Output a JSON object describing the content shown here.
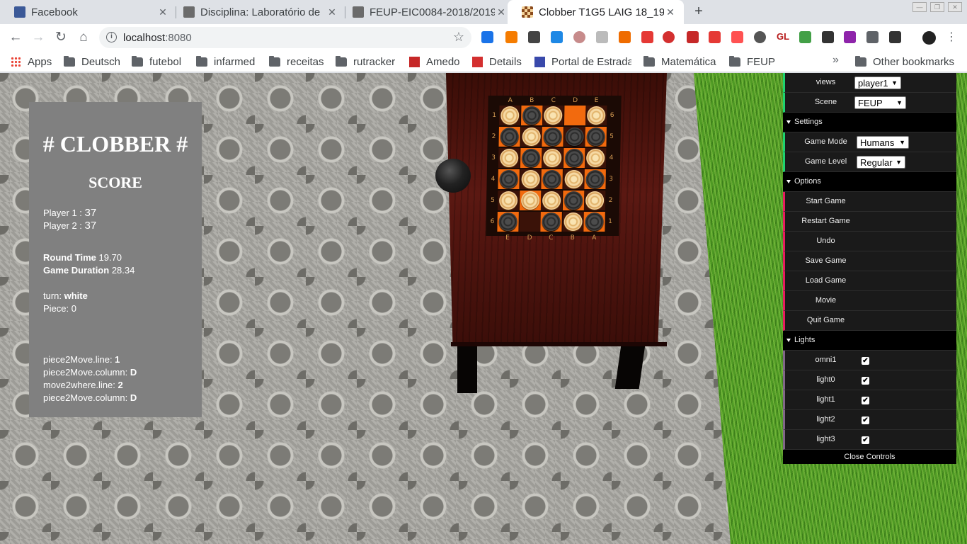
{
  "browser": {
    "tabs": [
      {
        "title": "Facebook",
        "icon": "facebook-icon",
        "color": "#3b5998",
        "active": false
      },
      {
        "title": "Disciplina: Laboratório de",
        "icon": "university-icon",
        "color": "#6b6b6b",
        "active": false
      },
      {
        "title": "FEUP-EIC0084-2018/2019-",
        "icon": "university-icon",
        "color": "#6b6b6b",
        "active": false
      },
      {
        "title": "Clobber T1G5 LAIG 18_19 (",
        "icon": "checkerboard-icon",
        "color": "#8b4a1c",
        "active": true
      }
    ],
    "new_tab": "+",
    "url_host": "localhost",
    "url_port": ":8080",
    "extension_text": {
      "gl": "GL"
    },
    "bookmarks": [
      {
        "label": "Apps",
        "type": "apps"
      },
      {
        "label": "Deutsch",
        "type": "folder"
      },
      {
        "label": "futebol",
        "type": "folder"
      },
      {
        "label": "infarmed",
        "type": "folder"
      },
      {
        "label": "receitas",
        "type": "folder"
      },
      {
        "label": "rutracker",
        "type": "folder"
      },
      {
        "label": "Amedo",
        "type": "site"
      },
      {
        "label": "Details",
        "type": "site"
      },
      {
        "label": "Portal de Estrada",
        "type": "site"
      },
      {
        "label": "Matemática",
        "type": "folder"
      },
      {
        "label": "FEUP",
        "type": "folder"
      }
    ],
    "more_bookmarks": "»",
    "other_bookmarks": "Other bookmarks"
  },
  "score_panel": {
    "title": "# CLOBBER #",
    "score_heading": "SCORE",
    "player1_label": "Player 1 : ",
    "player1_score": "37",
    "player2_label": "Player 2 : ",
    "player2_score": "37",
    "round_time_label": "Round Time",
    "round_time": "19.70",
    "game_duration_label": "Game Duration",
    "game_duration": "28.34",
    "turn_label": "turn: ",
    "turn": "white",
    "piece_label": "Piece: ",
    "piece": "0",
    "p2m_line_label": "piece2Move.line: ",
    "p2m_line": "1",
    "p2m_col_label": "piece2Move.column: ",
    "p2m_col": "D",
    "m2w_line_label": "move2where.line: ",
    "m2w_line": "2",
    "p2m_col2_label": "piece2Move.column: ",
    "p2m_col2": "D"
  },
  "board": {
    "col_labels": [
      "A",
      "B",
      "C",
      "D",
      "E"
    ],
    "col_labels_bottom": [
      "E",
      "D",
      "C",
      "B",
      "A"
    ],
    "row_labels": [
      "1",
      "2",
      "3",
      "4",
      "5",
      "6"
    ],
    "row_labels_right": [
      "6",
      "5",
      "4",
      "3",
      "2",
      "1"
    ],
    "cells": [
      [
        "white",
        "black",
        "white",
        "empty",
        "white"
      ],
      [
        "black",
        "white",
        "black",
        "black",
        "black"
      ],
      [
        "white",
        "black",
        "white",
        "black",
        "white"
      ],
      [
        "black",
        "white",
        "black",
        "white",
        "black"
      ],
      [
        "white",
        "white",
        "white",
        "black",
        "white"
      ],
      [
        "black",
        "empty",
        "black",
        "white",
        "black"
      ]
    ]
  },
  "controls": {
    "views_label": "views",
    "views_value": "player1",
    "scene_label": "Scene",
    "scene_value": "FEUP",
    "settings_label": "Settings",
    "game_mode_label": "Game Mode",
    "game_mode_value": "Humans",
    "game_level_label": "Game Level",
    "game_level_value": "Regular",
    "options_label": "Options",
    "options": [
      "Start Game",
      "Restart Game",
      "Undo",
      "Save Game",
      "Load Game",
      "Movie",
      "Quit Game"
    ],
    "lights_label": "Lights",
    "lights": [
      {
        "label": "omni1",
        "checked": true
      },
      {
        "label": "light0",
        "checked": true
      },
      {
        "label": "light1",
        "checked": true
      },
      {
        "label": "light2",
        "checked": true
      },
      {
        "label": "light3",
        "checked": true
      }
    ],
    "close_label": "Close Controls"
  }
}
